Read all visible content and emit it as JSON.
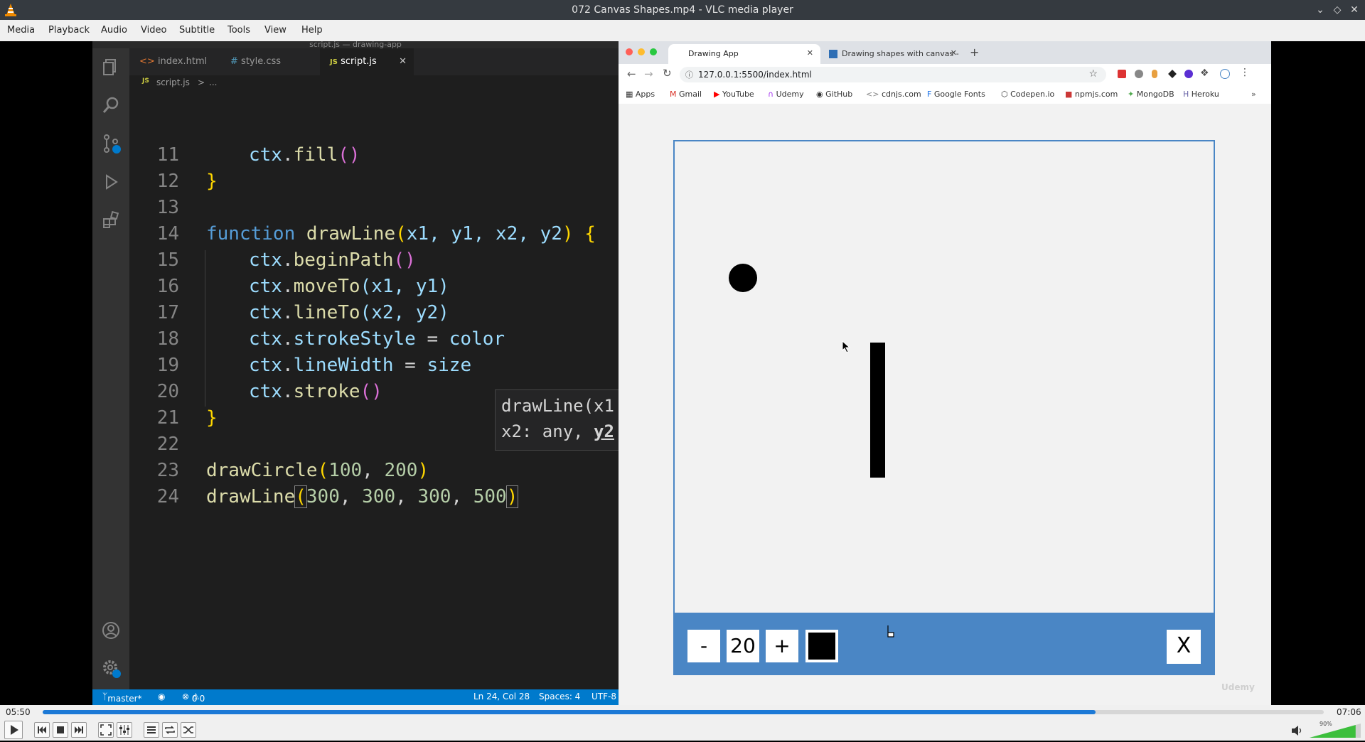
{
  "window": {
    "title": "072 Canvas Shapes.mp4 - VLC media player"
  },
  "menu": [
    "Media",
    "Playback",
    "Audio",
    "Video",
    "Subtitle",
    "Tools",
    "View",
    "Help"
  ],
  "vscode": {
    "window_title": "script.js — drawing-app",
    "tabs": [
      {
        "label": "index.html",
        "icon": "<>",
        "active": false
      },
      {
        "label": "style.css",
        "icon": "#",
        "active": false
      },
      {
        "label": "script.js",
        "icon": "JS",
        "active": true
      }
    ],
    "breadcrumb": {
      "file": "script.js",
      "rest": "...",
      "sep": ">"
    },
    "line_numbers": [
      "11",
      "12",
      "13",
      "14",
      "15",
      "16",
      "17",
      "18",
      "19",
      "20",
      "21",
      "22",
      "23",
      "24"
    ],
    "code": {
      "l11": {
        "obj": "ctx",
        "dot": ".",
        "fn": "fill",
        "paren": "()"
      },
      "l12": {
        "brace": "}"
      },
      "l14": {
        "kw": "function",
        "fn": "drawLine",
        "open": "(",
        "params": "x1, y1, x2, y2",
        "close": ")",
        "brace": "{"
      },
      "l15": {
        "obj": "ctx",
        "dot": ".",
        "fn": "beginPath",
        "paren": "()"
      },
      "l16": {
        "obj": "ctx",
        "dot": ".",
        "fn": "moveTo",
        "args": "(x1, y1)"
      },
      "l17": {
        "obj": "ctx",
        "dot": ".",
        "fn": "lineTo",
        "args": "(x2, y2)"
      },
      "l18": {
        "obj": "ctx",
        "dot": ".",
        "prop": "strokeStyle",
        "op": " = ",
        "val": "color"
      },
      "l19": {
        "obj": "ctx",
        "dot": ".",
        "prop": "lineWidth",
        "op": " = ",
        "val": "size"
      },
      "l20": {
        "obj": "ctx",
        "dot": ".",
        "fn": "stroke",
        "paren": "()"
      },
      "l21": {
        "brace": "}"
      },
      "l23": {
        "fn": "drawCircle",
        "open": "(",
        "a1": "100",
        "comma": ", ",
        "a2": "200",
        "close": ")"
      },
      "l24": {
        "fn": "drawLine",
        "open": "(",
        "a1": "300",
        "a2": "300",
        "a3": "300",
        "a4": "500",
        "comma": ", ",
        "close": ")"
      }
    },
    "tooltip": {
      "line1": "drawLine(x1",
      "line2": "x2: any, ",
      "line2b": "y2"
    },
    "status": {
      "branch": "master*",
      "errors": "0",
      "warnings": "0",
      "cursor": "Ln 24, Col 28",
      "spaces": "Spaces: 4",
      "encoding": "UTF-8"
    }
  },
  "browser": {
    "tabs": [
      {
        "label": "Drawing App",
        "active": true
      },
      {
        "label": "Drawing shapes with canvas -",
        "active": false
      }
    ],
    "url": "127.0.0.1:5500/index.html",
    "bookmarks": [
      "Apps",
      "Gmail",
      "YouTube",
      "Udemy",
      "GitHub",
      "cdnjs.com",
      "Google Fonts",
      "Codepen.io",
      "npmjs.com",
      "MongoDB",
      "Heroku"
    ],
    "toolbox": {
      "decrease": "-",
      "size": "20",
      "increase": "+",
      "color": "#000000",
      "clear": "X"
    },
    "watermark": "Udemy"
  },
  "player": {
    "elapsed": "05:50",
    "total": "07:06",
    "progress": 0.822,
    "volume_label": "90%",
    "volume": 0.9
  }
}
